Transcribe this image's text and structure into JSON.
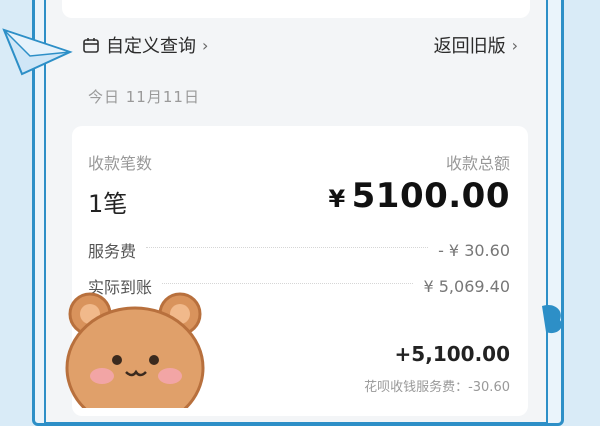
{
  "header": {
    "custom_query": "自定义查询",
    "back_old": "返回旧版"
  },
  "date": "今日 11月11日",
  "summary": {
    "count_label": "收款笔数",
    "total_label": "收款总额",
    "count": "1笔",
    "currency": "¥",
    "total": "5100.00"
  },
  "lines": [
    {
      "label": "服务费",
      "value": "- ¥ 30.60"
    },
    {
      "label": "实际到账",
      "value": "¥ 5,069.40"
    }
  ],
  "transaction": {
    "amount": "+5,100.00",
    "fee_note": "花呗收钱服务费：-30.60"
  },
  "colors": {
    "frame": "#2d8fc7",
    "background": "#d9ebf7",
    "card": "#ffffff"
  }
}
